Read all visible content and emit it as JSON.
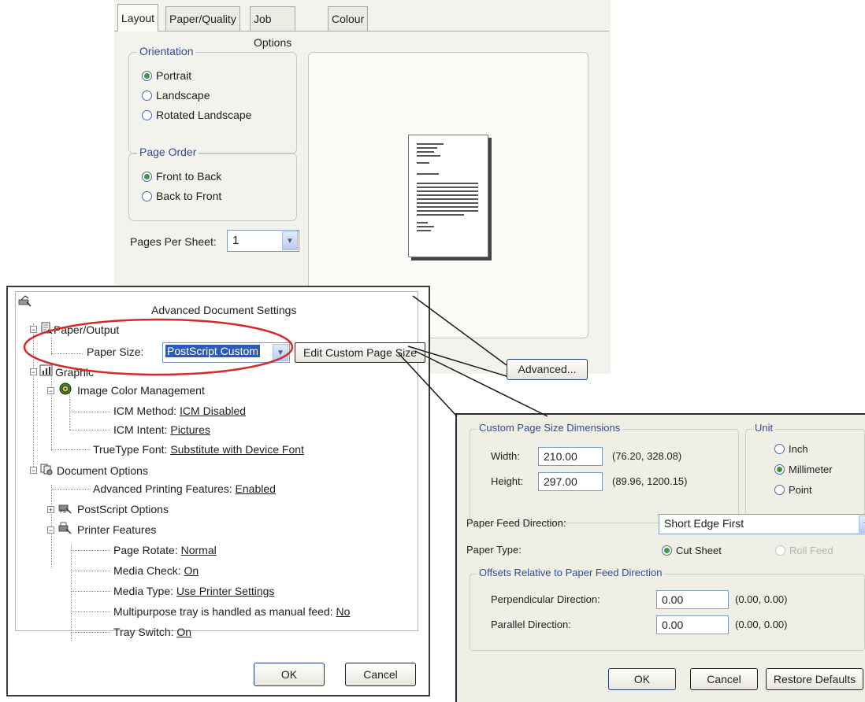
{
  "layout_dialog": {
    "tabs": [
      "Layout",
      "Paper/Quality",
      "Job Options",
      "Colour"
    ],
    "orientation": {
      "title": "Orientation",
      "options": [
        "Portrait",
        "Landscape",
        "Rotated Landscape"
      ],
      "selected": "Portrait"
    },
    "page_order": {
      "title": "Page Order",
      "options": [
        "Front to Back",
        "Back to Front"
      ],
      "selected": "Front to Back"
    },
    "pages_per_sheet": {
      "label": "Pages Per Sheet:",
      "value": "1"
    },
    "advanced_button": "Advanced..."
  },
  "advanced_dialog": {
    "title": "Advanced Document Settings",
    "paper_output": "Paper/Output",
    "paper_size_label": "Paper Size:",
    "paper_size_value": "PostScript Custom",
    "edit_custom_button": "Edit Custom Page Size",
    "graphic": "Graphic",
    "image_color_management": "Image Color Management",
    "icm_method_label": "ICM Method:",
    "icm_method_value": "ICM Disabled",
    "icm_intent_label": "ICM Intent:",
    "icm_intent_value": "Pictures",
    "truetype_label": "TrueType Font:",
    "truetype_value": "Substitute with Device Font",
    "document_options": "Document Options",
    "advanced_printing_label": "Advanced Printing Features:",
    "advanced_printing_value": "Enabled",
    "postscript_options": "PostScript Options",
    "printer_features": "Printer Features",
    "page_rotate_label": "Page Rotate:",
    "page_rotate_value": "Normal",
    "media_check_label": "Media Check:",
    "media_check_value": "On",
    "media_type_label": "Media Type:",
    "media_type_value": "Use Printer Settings",
    "multipurpose_label": "Multipurpose tray is handled as manual feed:",
    "multipurpose_value": "No",
    "tray_switch_label": "Tray Switch:",
    "tray_switch_value": "On",
    "ok": "OK",
    "cancel": "Cancel"
  },
  "custom_dialog": {
    "dimensions_title": "Custom Page Size Dimensions",
    "width_label": "Width:",
    "width_value": "210.00",
    "width_range": "(76.20, 328.08)",
    "height_label": "Height:",
    "height_value": "297.00",
    "height_range": "(89.96, 1200.15)",
    "unit_title": "Unit",
    "units": [
      "Inch",
      "Millimeter",
      "Point"
    ],
    "unit_selected": "Millimeter",
    "feed_direction_label": "Paper Feed Direction:",
    "feed_direction_value": "Short Edge First",
    "paper_type_label": "Paper Type:",
    "paper_type_options": [
      "Cut Sheet",
      "Roll Feed"
    ],
    "paper_type_selected": "Cut Sheet",
    "offsets_title": "Offsets Relative to Paper Feed Direction",
    "perpendicular_label": "Perpendicular Direction:",
    "perpendicular_value": "0.00",
    "perpendicular_range": "(0.00, 0.00)",
    "parallel_label": "Parallel Direction:",
    "parallel_value": "0.00",
    "parallel_range": "(0.00, 0.00)",
    "ok": "OK",
    "cancel": "Cancel",
    "restore_defaults": "Restore Defaults"
  },
  "colors": {
    "callout": "#d42a2a",
    "selection": "#2d5bb8",
    "title_blue": "#2f4e9a"
  }
}
